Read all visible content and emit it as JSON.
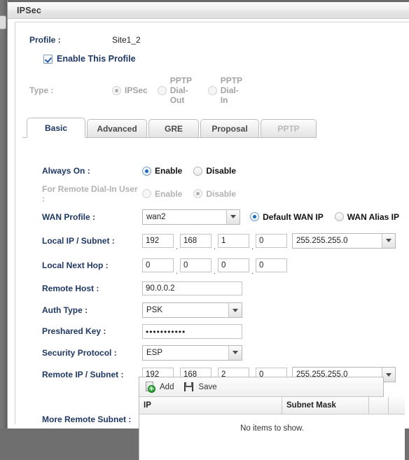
{
  "window": {
    "title": "IPSec"
  },
  "header": {
    "profile_label": "Profile :",
    "profile_value": "Site1_2",
    "enable_profile_label": "Enable This Profile",
    "enable_profile_checked": true,
    "type_label": "Type :",
    "type_options": [
      {
        "label": "IPSec",
        "selected": true
      },
      {
        "label": "PPTP Dial-Out",
        "line1": "PPTP",
        "line2": "Dial-",
        "line3": "Out",
        "selected": false
      },
      {
        "label": "PPTP Dial-In",
        "line1": "PPTP",
        "line2": "Dial-",
        "line3": "In",
        "selected": false
      }
    ]
  },
  "tabs": [
    {
      "label": "Basic",
      "active": true,
      "disabled": false
    },
    {
      "label": "Advanced",
      "active": false,
      "disabled": false
    },
    {
      "label": "GRE",
      "active": false,
      "disabled": false
    },
    {
      "label": "Proposal",
      "active": false,
      "disabled": false
    },
    {
      "label": "PPTP",
      "active": false,
      "disabled": true
    }
  ],
  "form": {
    "always_on": {
      "label": "Always On :",
      "enable_label": "Enable",
      "disable_label": "Disable",
      "value": "Enable"
    },
    "remote_dial_in": {
      "label": "For Remote Dial-In User :",
      "enable_label": "Enable",
      "disable_label": "Disable",
      "value": "Disable"
    },
    "wan_profile": {
      "label": "WAN Profile :",
      "value": "wan2",
      "default_wan_ip_label": "Default WAN IP",
      "wan_alias_ip_label": "WAN Alias IP",
      "ip_mode": "Default WAN IP"
    },
    "local_ip_subnet": {
      "label": "Local IP / Subnet :",
      "octets": [
        "192",
        "168",
        "1",
        "0"
      ],
      "mask": "255.255.255.0"
    },
    "local_next_hop": {
      "label": "Local Next Hop :",
      "octets": [
        "0",
        "0",
        "0",
        "0"
      ]
    },
    "remote_host": {
      "label": "Remote Host :",
      "value": "90.0.0.2"
    },
    "auth_type": {
      "label": "Auth Type :",
      "value": "PSK"
    },
    "preshared_key": {
      "label": "Preshared Key :",
      "value": "•••••••••••"
    },
    "security_protocol": {
      "label": "Security Protocol :",
      "value": "ESP"
    },
    "remote_ip_subnet": {
      "label": "Remote IP / Subnet :",
      "octets": [
        "192",
        "168",
        "2",
        "0"
      ],
      "mask": "255.255.255.0"
    },
    "more_remote_subnet": {
      "label": "More Remote Subnet :",
      "toolbar": {
        "add_label": "Add",
        "save_label": "Save"
      },
      "columns": [
        "IP",
        "Subnet Mask",
        "",
        ""
      ],
      "rows": [],
      "empty_text": "No items to show."
    }
  },
  "icons": {
    "add": "add-icon",
    "save": "save-icon",
    "dropdown": "chevron-down-icon",
    "checkbox": "checkbox-checked-icon"
  },
  "colors": {
    "label_blue": "#1f3864",
    "radio_selected_blue": "#1a6bc4",
    "window_chrome": "#e6e6e6",
    "disabled_grey": "#b2b2b2"
  }
}
